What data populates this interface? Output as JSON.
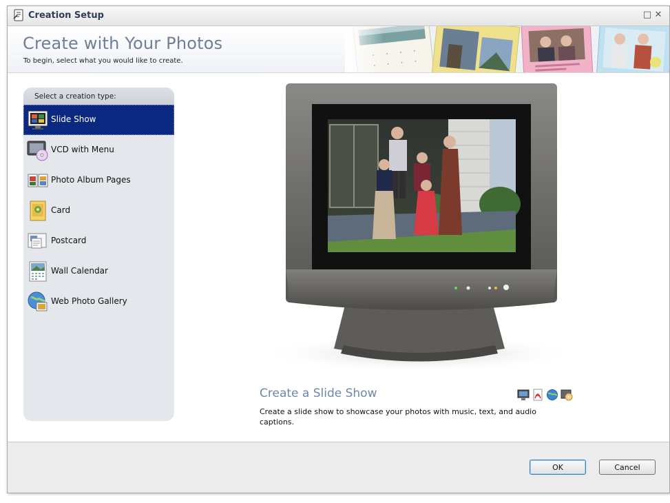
{
  "window": {
    "title": "Creation Setup",
    "controls": {
      "maximize": "□",
      "close": "✕"
    }
  },
  "header": {
    "title": "Create with Your Photos",
    "subtitle": "To begin, select what you would like to create."
  },
  "sidebar": {
    "heading": "Select a creation type:",
    "selected_index": 0,
    "items": [
      {
        "label": "Slide Show",
        "icon": "slideshow-icon"
      },
      {
        "label": "VCD with Menu",
        "icon": "vcd-icon"
      },
      {
        "label": "Photo Album Pages",
        "icon": "album-pages-icon"
      },
      {
        "label": "Card",
        "icon": "card-icon"
      },
      {
        "label": "Postcard",
        "icon": "postcard-icon"
      },
      {
        "label": "Wall Calendar",
        "icon": "wall-calendar-icon"
      },
      {
        "label": "Web Photo Gallery",
        "icon": "web-gallery-icon"
      }
    ]
  },
  "preview": {
    "title": "Create a Slide Show",
    "description": "Create a slide show to showcase your photos with music, text, and audio captions.",
    "output_icons": [
      "monitor-icon",
      "pdf-icon",
      "web-icon",
      "burn-disc-icon"
    ]
  },
  "footer": {
    "ok_label": "OK",
    "cancel_label": "Cancel"
  },
  "colors": {
    "selected_bg": "#0a2880",
    "title_color": "#6f7e95",
    "desc_title_color": "#6f86a8"
  }
}
